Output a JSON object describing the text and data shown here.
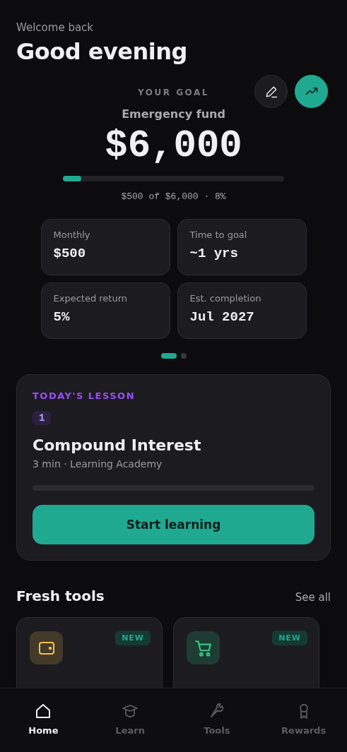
{
  "header": {
    "greeting": "Welcome back",
    "title": "Good evening"
  },
  "goal": {
    "eyebrow": "YOUR GOAL",
    "name": "Emergency fund",
    "amount": "$6,000",
    "level": 0.083,
    "caption": "$500 of $6,000 · 8%",
    "actions": [
      {
        "kind": "edit",
        "primary": false
      },
      {
        "kind": "trend",
        "primary": true
      }
    ],
    "stats": [
      {
        "label": "Monthly",
        "value": "$500"
      },
      {
        "label": "Time to goal",
        "value": "~1 yrs"
      },
      {
        "label": "Expected return",
        "value": "5%"
      },
      {
        "label": "Est. completion",
        "value": "Jul 2027"
      }
    ],
    "pages": [
      {
        "selected": true
      },
      {
        "selected": false
      }
    ]
  },
  "lesson": {
    "eyebrow": "TODAY'S LESSON",
    "number": "1",
    "title": "Compound Interest",
    "meta": "3 min · Learning Academy",
    "level": 0,
    "button": "Start learning"
  },
  "tools": {
    "title": "Fresh tools",
    "link": "See all",
    "items": [
      {
        "kind": "wallet",
        "badge": "NEW",
        "color": "#f2c14e"
      },
      {
        "kind": "cart",
        "badge": "NEW",
        "color": "#2ecc85"
      }
    ]
  },
  "nav": [
    {
      "kind": "home",
      "label": "Home",
      "selected": true
    },
    {
      "kind": "learn",
      "label": "Learn",
      "selected": false
    },
    {
      "kind": "tools",
      "label": "Tools",
      "selected": false
    },
    {
      "kind": "rewards",
      "label": "Rewards",
      "selected": false
    }
  ]
}
